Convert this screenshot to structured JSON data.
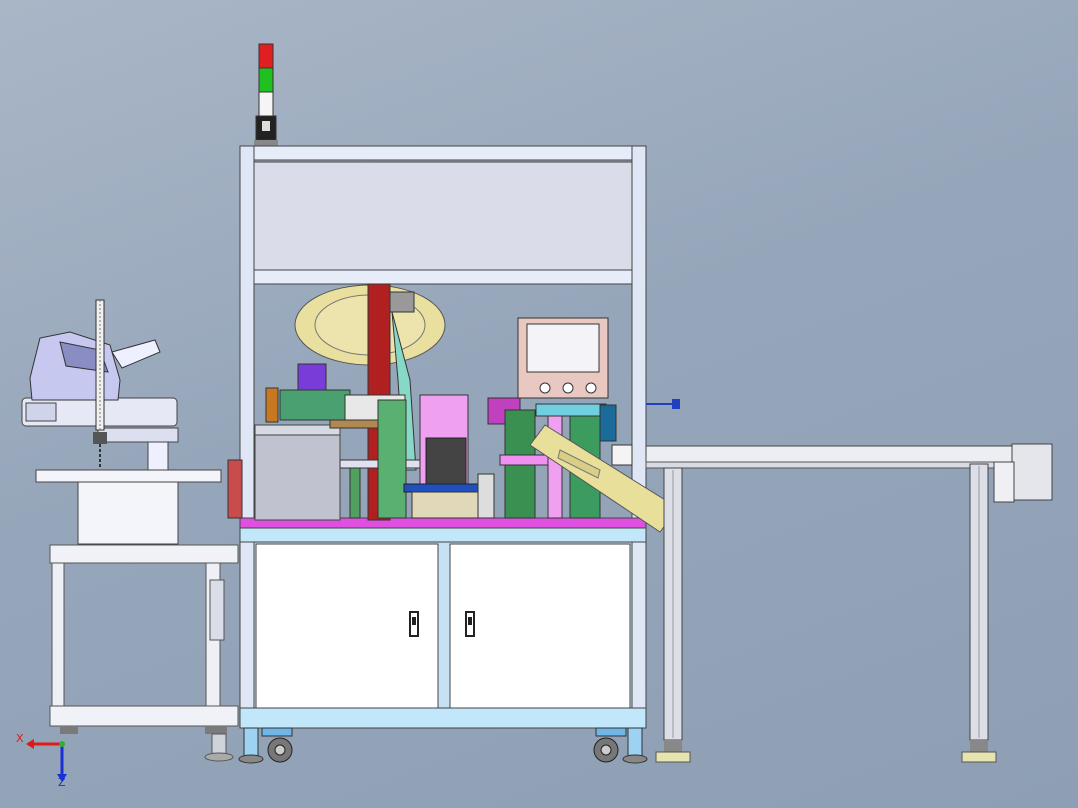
{
  "axes": {
    "x_label": "X",
    "z_label": "Z",
    "x_color": "#e01818",
    "z_color": "#1a2fd6"
  },
  "colors": {
    "background": "#96a6ba",
    "frame": "#c8d4e8",
    "cabinet": "#ffffff",
    "magenta": "#e050e0",
    "green": "#2ec04a",
    "reel": "#e9e0a0",
    "tray": "#e8df9a",
    "hmi_screen": "#f4f4f8",
    "hmi_body": "#e8c8c0",
    "lamp_red": "#e02020",
    "lamp_green": "#20c020"
  },
  "icons": {
    "stack_light": "stack-light-icon",
    "hmi": "hmi-panel-icon",
    "robot": "robot-arm-icon",
    "axis_triad": "axis-triad-icon"
  }
}
